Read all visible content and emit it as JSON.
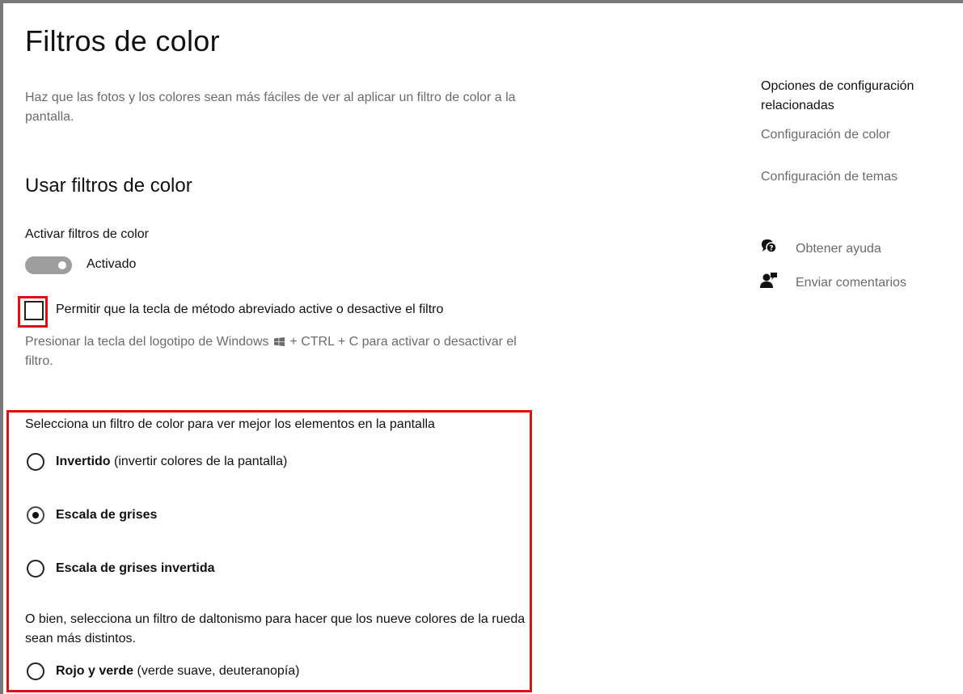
{
  "page": {
    "title": "Filtros de color",
    "description": "Haz que las fotos y los colores sean más fáciles de ver al aplicar un filtro de color a la pantalla."
  },
  "section": {
    "heading": "Usar filtros de color",
    "toggle_label": "Activar filtros de color",
    "toggle_state": "Activado",
    "toggle_on": true,
    "shortcut_checkbox_label": "Permitir que la tecla de método abreviado active o desactive el filtro",
    "shortcut_checked": false,
    "hint_before": "Presionar la tecla del logotipo de Windows",
    "hint_after": "+ CTRL + C para activar o desactivar el filtro.",
    "hint_icon": "windows-logo-icon"
  },
  "filters": {
    "prompt": "Selecciona un filtro de color para ver mejor los elementos en la pantalla",
    "options": [
      {
        "bold": "Invertido",
        "rest": "(invertir colores de la pantalla)",
        "selected": false
      },
      {
        "bold": "Escala de grises",
        "rest": "",
        "selected": true
      },
      {
        "bold": "Escala de grises invertida",
        "rest": "",
        "selected": false
      }
    ],
    "colorblind_prompt": "O bien, selecciona un filtro de daltonismo para hacer que los nueve colores de la rueda sean más distintos.",
    "colorblind_options": [
      {
        "bold": "Rojo y verde",
        "rest": "(verde suave, deuteranopía)",
        "selected": false
      }
    ]
  },
  "sidebar": {
    "heading": "Opciones de configuración relacionadas",
    "links": [
      "Configuración de color",
      "Configuración de temas"
    ],
    "help": {
      "label": "Obtener ayuda",
      "icon": "help-chat-icon"
    },
    "feedback": {
      "label": "Enviar comentarios",
      "icon": "feedback-person-icon"
    }
  },
  "colors": {
    "highlight": "#e01010",
    "toggle_track": "#9e9e9e",
    "secondary_text": "#6b6b6b"
  }
}
